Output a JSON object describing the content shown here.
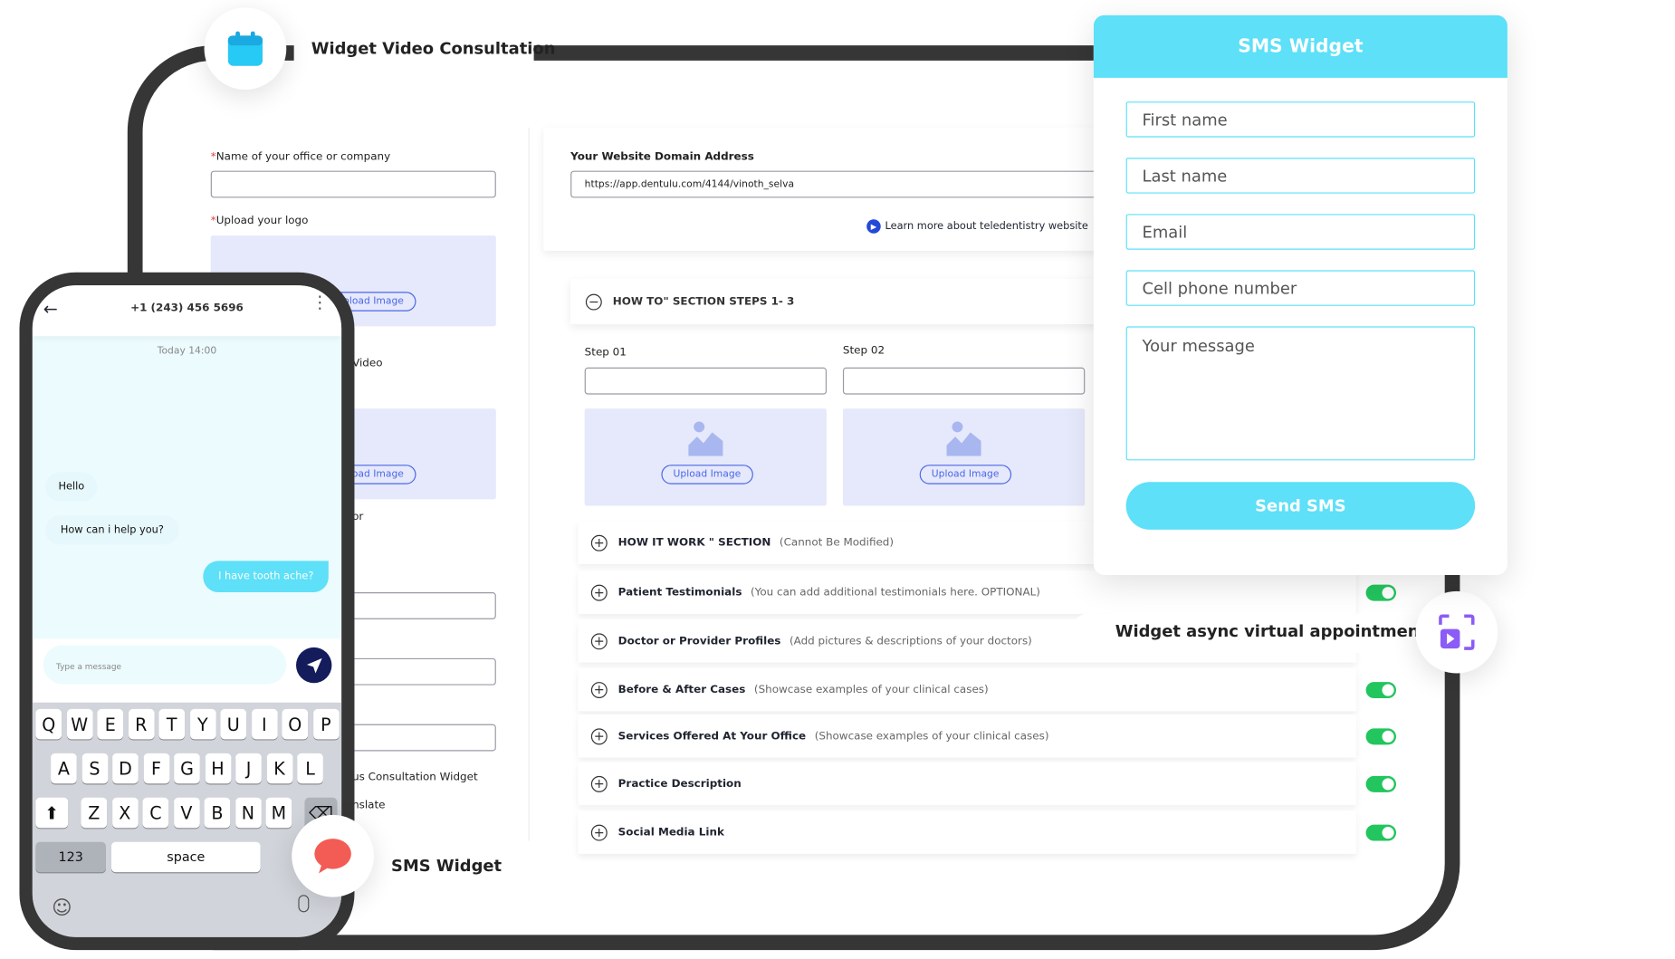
{
  "tablet": {
    "title": "Widget Video Consultation",
    "left_form": {
      "office_label": "Name of your office or company",
      "office_value": "",
      "logo_label": "Upload your logo",
      "upload_label": "Upload Image",
      "fragment_video": "Video",
      "fragment_or": "or",
      "fragment_widget": "us Consultation Widget",
      "fragment_translate": "nslate"
    },
    "domain": {
      "label": "Your Website Domain Address",
      "value": "https://app.dentulu.com/4144/vinoth_selva",
      "learn_more": "Learn more about teledentistry website"
    },
    "how_to": {
      "title": "HOW TO\" SECTION STEPS 1- 3",
      "steps": [
        {
          "label": "Step 01",
          "value": "",
          "upload": "Upload Image"
        },
        {
          "label": "Step 02",
          "value": "",
          "upload": "Upload Image"
        }
      ]
    },
    "sections": [
      {
        "title": "HOW IT WORK \" SECTION",
        "note": "(Cannot Be Modified)",
        "toggle": null
      },
      {
        "title": "Patient Testimonials",
        "note": "(You can add additional testimonials here. OPTIONAL)",
        "toggle": true
      },
      {
        "title": "Doctor or Provider Profiles",
        "note": "(Add pictures & descriptions of your doctors)",
        "toggle": null
      },
      {
        "title": "Before & After Cases",
        "note": "(Showcase examples of your clinical cases)",
        "toggle": true
      },
      {
        "title": "Services Offered At Your Office",
        "note": "(Showcase examples of your clinical cases)",
        "toggle": true
      },
      {
        "title": "Practice Description",
        "note": "",
        "toggle": true
      },
      {
        "title": "Social Media Link",
        "note": "",
        "toggle": true
      }
    ],
    "async_label": "Widget async virtual appointments",
    "sms_label": "SMS Widget"
  },
  "sms_widget": {
    "title": "SMS Widget",
    "first_name": "First name",
    "last_name": "Last name",
    "email": "Email",
    "phone": "Cell phone number",
    "message": "Your message",
    "send": "Send SMS"
  },
  "phone": {
    "number": "+1 (243) 456 5696",
    "timestamp": "Today 14:00",
    "messages": [
      {
        "text": "Hello",
        "from": "them"
      },
      {
        "text": "How can i help you?",
        "from": "them"
      },
      {
        "text": "I have tooth ache?",
        "from": "me"
      }
    ],
    "input_placeholder": "Type a message",
    "keyboard": {
      "row1": [
        "Q",
        "W",
        "E",
        "R",
        "T",
        "Y",
        "U",
        "I",
        "O",
        "P"
      ],
      "row2": [
        "A",
        "S",
        "D",
        "F",
        "G",
        "H",
        "J",
        "K",
        "L"
      ],
      "row3": [
        "Z",
        "X",
        "C",
        "V",
        "B",
        "N",
        "M"
      ],
      "numbers": "123",
      "space": "space"
    }
  },
  "colors": {
    "cyan": "#5de0f8",
    "frame": "#363636",
    "toggle": "#22c55e",
    "upload_bg": "#e6e9fb",
    "send": "#141c5c",
    "chat_icon": "#f25c54"
  }
}
